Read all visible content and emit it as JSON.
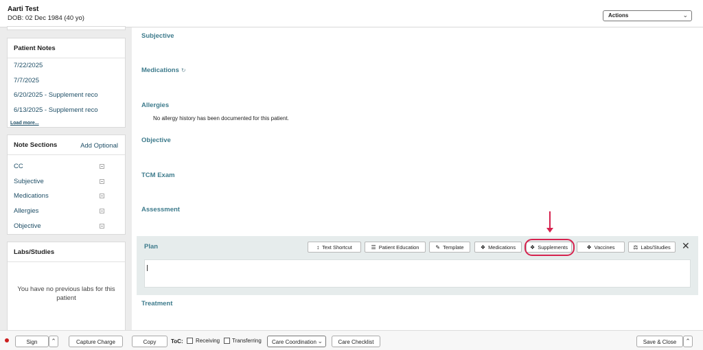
{
  "header": {
    "patient_name": "Aarti Test",
    "dob": "DOB: 02 Dec 1984 (40 yo)",
    "actions_label": "Actions"
  },
  "patient_notes": {
    "title": "Patient Notes",
    "items": [
      "7/22/2025",
      "7/7/2025",
      "6/20/2025 - Supplement reco",
      "6/13/2025 - Supplement reco"
    ],
    "load_more": "Load more..."
  },
  "note_sections": {
    "title": "Note Sections",
    "add_optional": "Add Optional",
    "items": [
      "CC",
      "Subjective",
      "Medications",
      "Allergies",
      "Objective"
    ]
  },
  "labs": {
    "title": "Labs/Studies",
    "empty_message": "You have no previous labs for this patient"
  },
  "main": {
    "sections": {
      "subjective": "Subjective",
      "medications": "Medications",
      "allergies": "Allergies",
      "objective": "Objective",
      "tcm_exam": "TCM Exam",
      "assessment": "Assessment",
      "treatment": "Treatment"
    },
    "allergy_note": "No allergy history has been documented for this patient."
  },
  "plan": {
    "title": "Plan",
    "toolbar": [
      {
        "label": "Text Shortcut",
        "icon": "text-shortcut-icon"
      },
      {
        "label": "Patient Education",
        "icon": "book-icon"
      },
      {
        "label": "Template",
        "icon": "template-icon"
      },
      {
        "label": "Medications",
        "icon": "pill-icon"
      },
      {
        "label": "Supplements",
        "icon": "pill-icon"
      },
      {
        "label": "Vaccines",
        "icon": "syringe-icon"
      },
      {
        "label": "Labs/Studies",
        "icon": "flask-icon"
      }
    ],
    "text_value": ""
  },
  "footer": {
    "sign": "Sign",
    "capture_charge": "Capture Charge",
    "copy": "Copy",
    "toc_label": "ToC:",
    "receiving": "Receiving",
    "transferring": "Transferring",
    "care_coordination": "Care Coordination",
    "care_checklist": "Care Checklist",
    "save_close": "Save & Close"
  },
  "colors": {
    "section_heading": "#3e7b8c",
    "link": "#1e4e66",
    "highlight": "#d6224e",
    "status_dot": "#cc1f1f"
  }
}
